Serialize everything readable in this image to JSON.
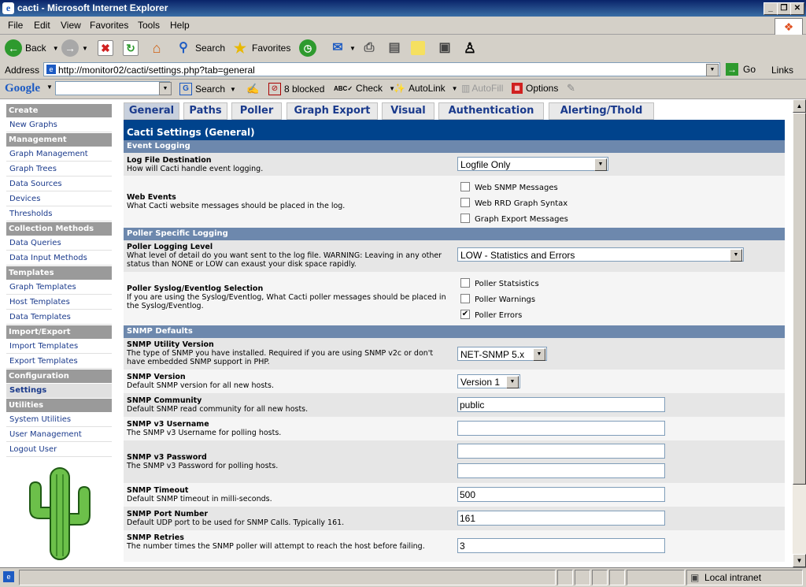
{
  "window": {
    "title": "cacti - Microsoft Internet Explorer"
  },
  "menu": [
    "File",
    "Edit",
    "View",
    "Favorites",
    "Tools",
    "Help"
  ],
  "toolbar": {
    "back": "Back",
    "search": "Search",
    "favorites": "Favorites"
  },
  "address": {
    "label": "Address",
    "url": "http://monitor02/cacti/settings.php?tab=general",
    "go": "Go",
    "links": "Links"
  },
  "google": {
    "logo": "Google",
    "search": "Search",
    "blocked": "8 blocked",
    "check": "Check",
    "autolink": "AutoLink",
    "autofill": "AutoFill",
    "options": "Options"
  },
  "sidebar": {
    "create": "Create",
    "new_graphs": "New Graphs",
    "management": "Management",
    "graph_management": "Graph Management",
    "graph_trees": "Graph Trees",
    "data_sources": "Data Sources",
    "devices": "Devices",
    "thresholds": "Thresholds",
    "collection": "Collection Methods",
    "data_queries": "Data Queries",
    "data_input": "Data Input Methods",
    "templates": "Templates",
    "graph_templates": "Graph Templates",
    "host_templates": "Host Templates",
    "data_templates": "Data Templates",
    "importexport": "Import/Export",
    "import_templates": "Import Templates",
    "export_templates": "Export Templates",
    "configuration": "Configuration",
    "settings": "Settings",
    "utilities": "Utilities",
    "system_utilities": "System Utilities",
    "user_management": "User Management",
    "logout": "Logout User"
  },
  "tabs": [
    "General",
    "Paths",
    "Poller",
    "Graph Export",
    "Visual",
    "Authentication",
    "Alerting/Thold"
  ],
  "settings": {
    "title": "Cacti Settings (General)",
    "event_logging": "Event Logging",
    "log_dest_title": "Log File Destination",
    "log_dest_desc": "How will Cacti handle event logging.",
    "log_dest_value": "Logfile Only",
    "web_events_title": "Web Events",
    "web_events_desc": "What Cacti website messages should be placed in the log.",
    "web_snmp": "Web SNMP Messages",
    "web_rrd": "Web RRD Graph Syntax",
    "graph_export_msgs": "Graph Export Messages",
    "poller_logging": "Poller Specific Logging",
    "poller_level_title": "Poller Logging Level",
    "poller_level_desc": "What level of detail do you want sent to the log file. WARNING: Leaving in any other status than NONE or LOW can exaust your disk space rapidly.",
    "poller_level_value": "LOW - Statistics and Errors",
    "syslog_title": "Poller Syslog/Eventlog Selection",
    "syslog_desc": "If you are using the Syslog/Eventlog, What Cacti poller messages should be placed in the Syslog/Eventlog.",
    "poller_stats": "Poller Statsistics",
    "poller_warnings": "Poller Warnings",
    "poller_errors": "Poller Errors",
    "check_mark": "✔",
    "snmp_defaults": "SNMP Defaults",
    "snmp_util_title": "SNMP Utility Version",
    "snmp_util_desc": "The type of SNMP you have installed. Required if you are using SNMP v2c or don't have embedded SNMP support in PHP.",
    "snmp_util_value": "NET-SNMP 5.x",
    "snmp_ver_title": "SNMP Version",
    "snmp_ver_desc": "Default SNMP version for all new hosts.",
    "snmp_ver_value": "Version 1",
    "snmp_comm_title": "SNMP Community",
    "snmp_comm_desc": "Default SNMP read community for all new hosts.",
    "snmp_comm_value": "public",
    "snmp_user_title": "SNMP v3 Username",
    "snmp_user_desc": "The SNMP v3 Username for polling hosts.",
    "snmp_pass_title": "SNMP v3 Password",
    "snmp_pass_desc": "The SNMP v3 Password for polling hosts.",
    "snmp_timeout_title": "SNMP Timeout",
    "snmp_timeout_desc": "Default SNMP timeout in milli-seconds.",
    "snmp_timeout_value": "500",
    "snmp_port_title": "SNMP Port Number",
    "snmp_port_desc": "Default UDP port to be used for SNMP Calls. Typically 161.",
    "snmp_port_value": "161",
    "snmp_retries_title": "SNMP Retries",
    "snmp_retries_desc": "The number times the SNMP poller will attempt to reach the host before failing.",
    "snmp_retries_value": "3"
  },
  "status": {
    "zone": "Local intranet"
  }
}
